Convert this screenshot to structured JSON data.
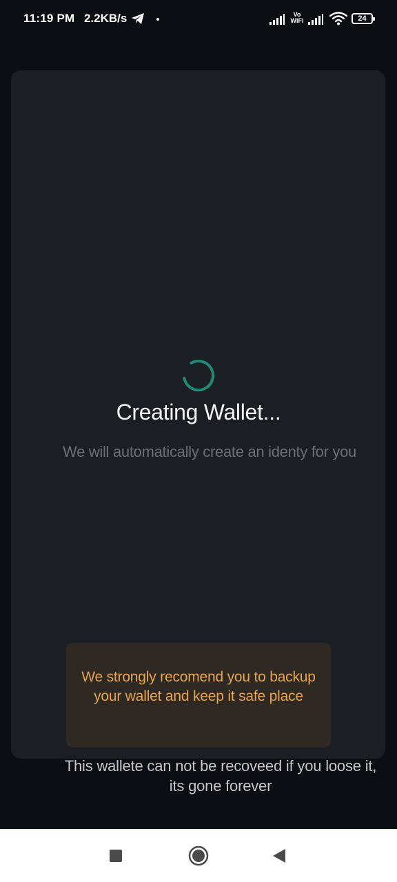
{
  "status_bar": {
    "time": "11:19 PM",
    "network_speed": "2.2KB/s",
    "vowifi_line1": "Vo",
    "vowifi_line2": "WiFi",
    "battery_level": "24",
    "icons": [
      "telegram-icon",
      "signal-icon",
      "wifi-icon",
      "battery-icon"
    ]
  },
  "main": {
    "title": "Creating Wallet...",
    "subtitle": "We will automatically create an identy for you",
    "warning": "We strongly recomend you to backup your wallet and keep it safe place",
    "note": "This wallete can not be recoveed if you loose it, its gone forever"
  },
  "nav_bar": {
    "icons": [
      "recents-icon",
      "home-icon",
      "back-icon"
    ]
  },
  "colors": {
    "background": "#0b0e12",
    "card": "#1b1e23",
    "spinner": "#1f8a7a",
    "warning_bg": "#2e2923",
    "warning_text": "#e6a452"
  }
}
